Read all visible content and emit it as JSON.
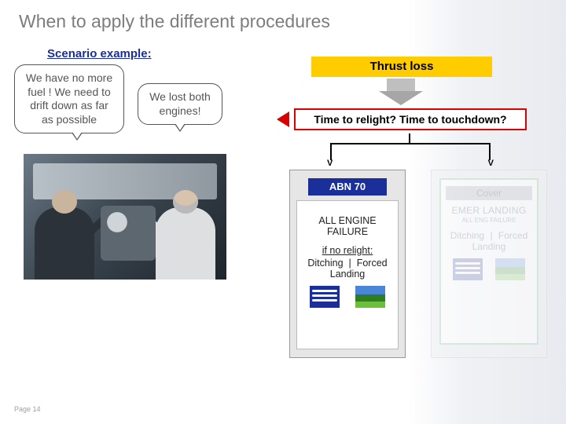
{
  "title": "When to apply the different procedures",
  "scenario_label": "Scenario example",
  "bubbles": {
    "b1": "We have no more fuel ! We need to drift down as far as possible",
    "b2": "We lost both engines!"
  },
  "flow": {
    "thrust_loss": "Thrust loss",
    "decision": "Time to relight? Time to touchdown?",
    "branch_marker": "V"
  },
  "cardA": {
    "header": "ABN 70",
    "line1": "ALL ENGINE",
    "line2": "FAILURE",
    "if_label": "if no relight:",
    "opt_left": "Ditching",
    "sep": "|",
    "opt_right": "Forced Landing"
  },
  "cardB": {
    "cover": "Cover",
    "title1": "EMER LANDING",
    "title2": "ALL ENG FAILURE",
    "opt_left": "Ditching",
    "sep": "|",
    "opt_right": "Forced Landing"
  },
  "page_label": "Page 14"
}
